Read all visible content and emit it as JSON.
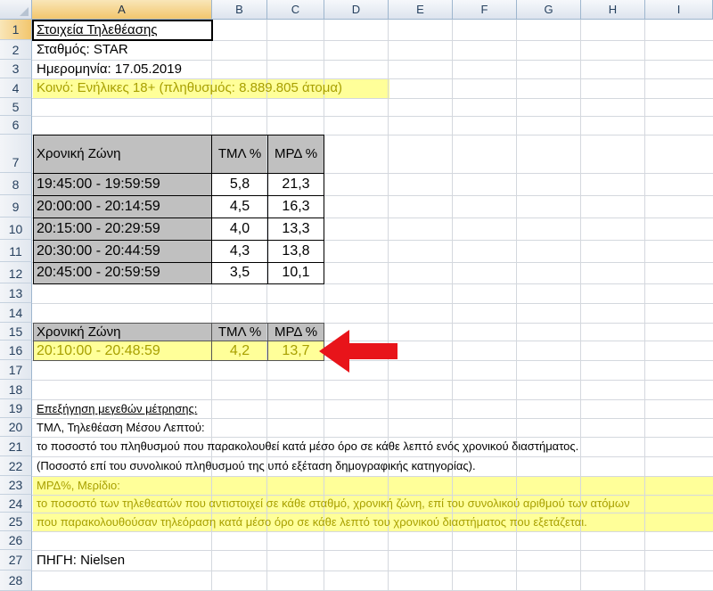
{
  "columns": [
    "A",
    "B",
    "C",
    "D",
    "E",
    "F",
    "G",
    "H",
    "I"
  ],
  "rows": [
    "1",
    "2",
    "3",
    "4",
    "5",
    "6",
    "7",
    "8",
    "9",
    "10",
    "11",
    "12",
    "13",
    "14",
    "15",
    "16",
    "17",
    "18",
    "19",
    "20",
    "21",
    "22",
    "23",
    "24",
    "25",
    "26",
    "27",
    "28"
  ],
  "info": {
    "title": "Στοιχεία Τηλεθέασης",
    "station": "Σταθμός: STAR",
    "date": "Ημερομηνία: 17.05.2019",
    "audience": "Κοινό: Ενήλικες 18+ (πληθυσμός: 8.889.805 άτομα)"
  },
  "table1": {
    "headers": [
      "Χρονική Ζώνη",
      "ΤΜΛ %",
      "ΜΡΔ %"
    ],
    "rows": [
      [
        "19:45:00 - 19:59:59",
        "5,8",
        "21,3"
      ],
      [
        "20:00:00 - 20:14:59",
        "4,5",
        "16,3"
      ],
      [
        "20:15:00 - 20:29:59",
        "4,0",
        "13,3"
      ],
      [
        "20:30:00 - 20:44:59",
        "4,3",
        "13,8"
      ],
      [
        "20:45:00 - 20:59:59",
        "3,5",
        "10,1"
      ]
    ]
  },
  "table2": {
    "headers": [
      "Χρονική Ζώνη",
      "ΤΜΛ %",
      "ΜΡΔ %"
    ],
    "row": [
      "20:10:00 - 20:48:59",
      "4,2",
      "13,7"
    ]
  },
  "notes": {
    "heading": "Επεξήγηση μεγεθών μέτρησης:",
    "tml_title": "ΤΜΛ, Τηλεθέαση Μέσου Λεπτού:",
    "tml_line1": "το ποσοστό του πληθυσμού που παρακολουθεί κατά μέσο όρο σε κάθε λεπτό ενός χρονικού διαστήματος.",
    "tml_line2": "(Ποσοστό επί του συνολικού πληθυσμού της υπό εξέταση δημογραφικής κατηγορίας).",
    "mrd_title": "ΜΡΔ%, Μερίδιο:",
    "mrd_line1": "το ποσοστό των τηλεθεατών που αντιστοιχεί σε κάθε σταθμό, χρονική ζώνη, επί του συνολικού αριθμού των ατόμων",
    "mrd_line2": "που παρακολουθούσαν τηλεόραση κατά μέσο όρο σε κάθε λεπτό του χρονικού διαστήματος που εξετάζεται."
  },
  "source": "ΠΗΓΗ: Nielsen",
  "colors": {
    "highlight": "#ffff99",
    "header_fill": "#c0c0c0",
    "arrow": "#e8141a",
    "highlight_text": "#a8a000"
  }
}
